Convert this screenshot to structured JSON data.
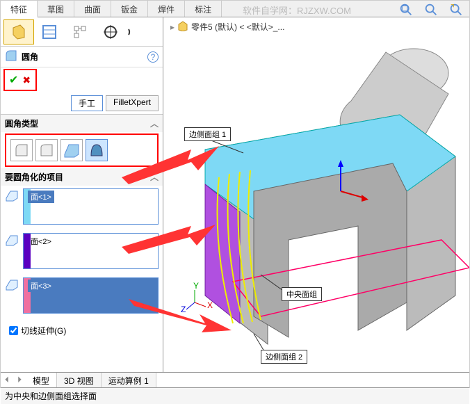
{
  "tabs": {
    "t0": "特征",
    "t1": "草图",
    "t2": "曲面",
    "t3": "钣金",
    "t4": "焊件",
    "t5": "标注"
  },
  "watermark": "软件自学网：RJZXW.COM",
  "crumb": {
    "part": "零件5 (默认) < <默认>_..."
  },
  "feature": {
    "name": "圆角"
  },
  "toggle": {
    "manual": "手工",
    "expert": "FilletXpert"
  },
  "sections": {
    "type": "圆角类型",
    "items": "要圆角化的项目"
  },
  "faces": {
    "f1": "面<1>",
    "f2": "面<2>",
    "f3": "面<3>"
  },
  "tangent": "切线延伸(G)",
  "labels": {
    "side1": "边侧面组 1",
    "center": "中央面组",
    "side2": "边侧面组 2"
  },
  "bottom": {
    "t0": "模型",
    "t1": "3D 视图",
    "t2": "运动算例 1"
  },
  "status": "为中央和边侧面组选择面"
}
